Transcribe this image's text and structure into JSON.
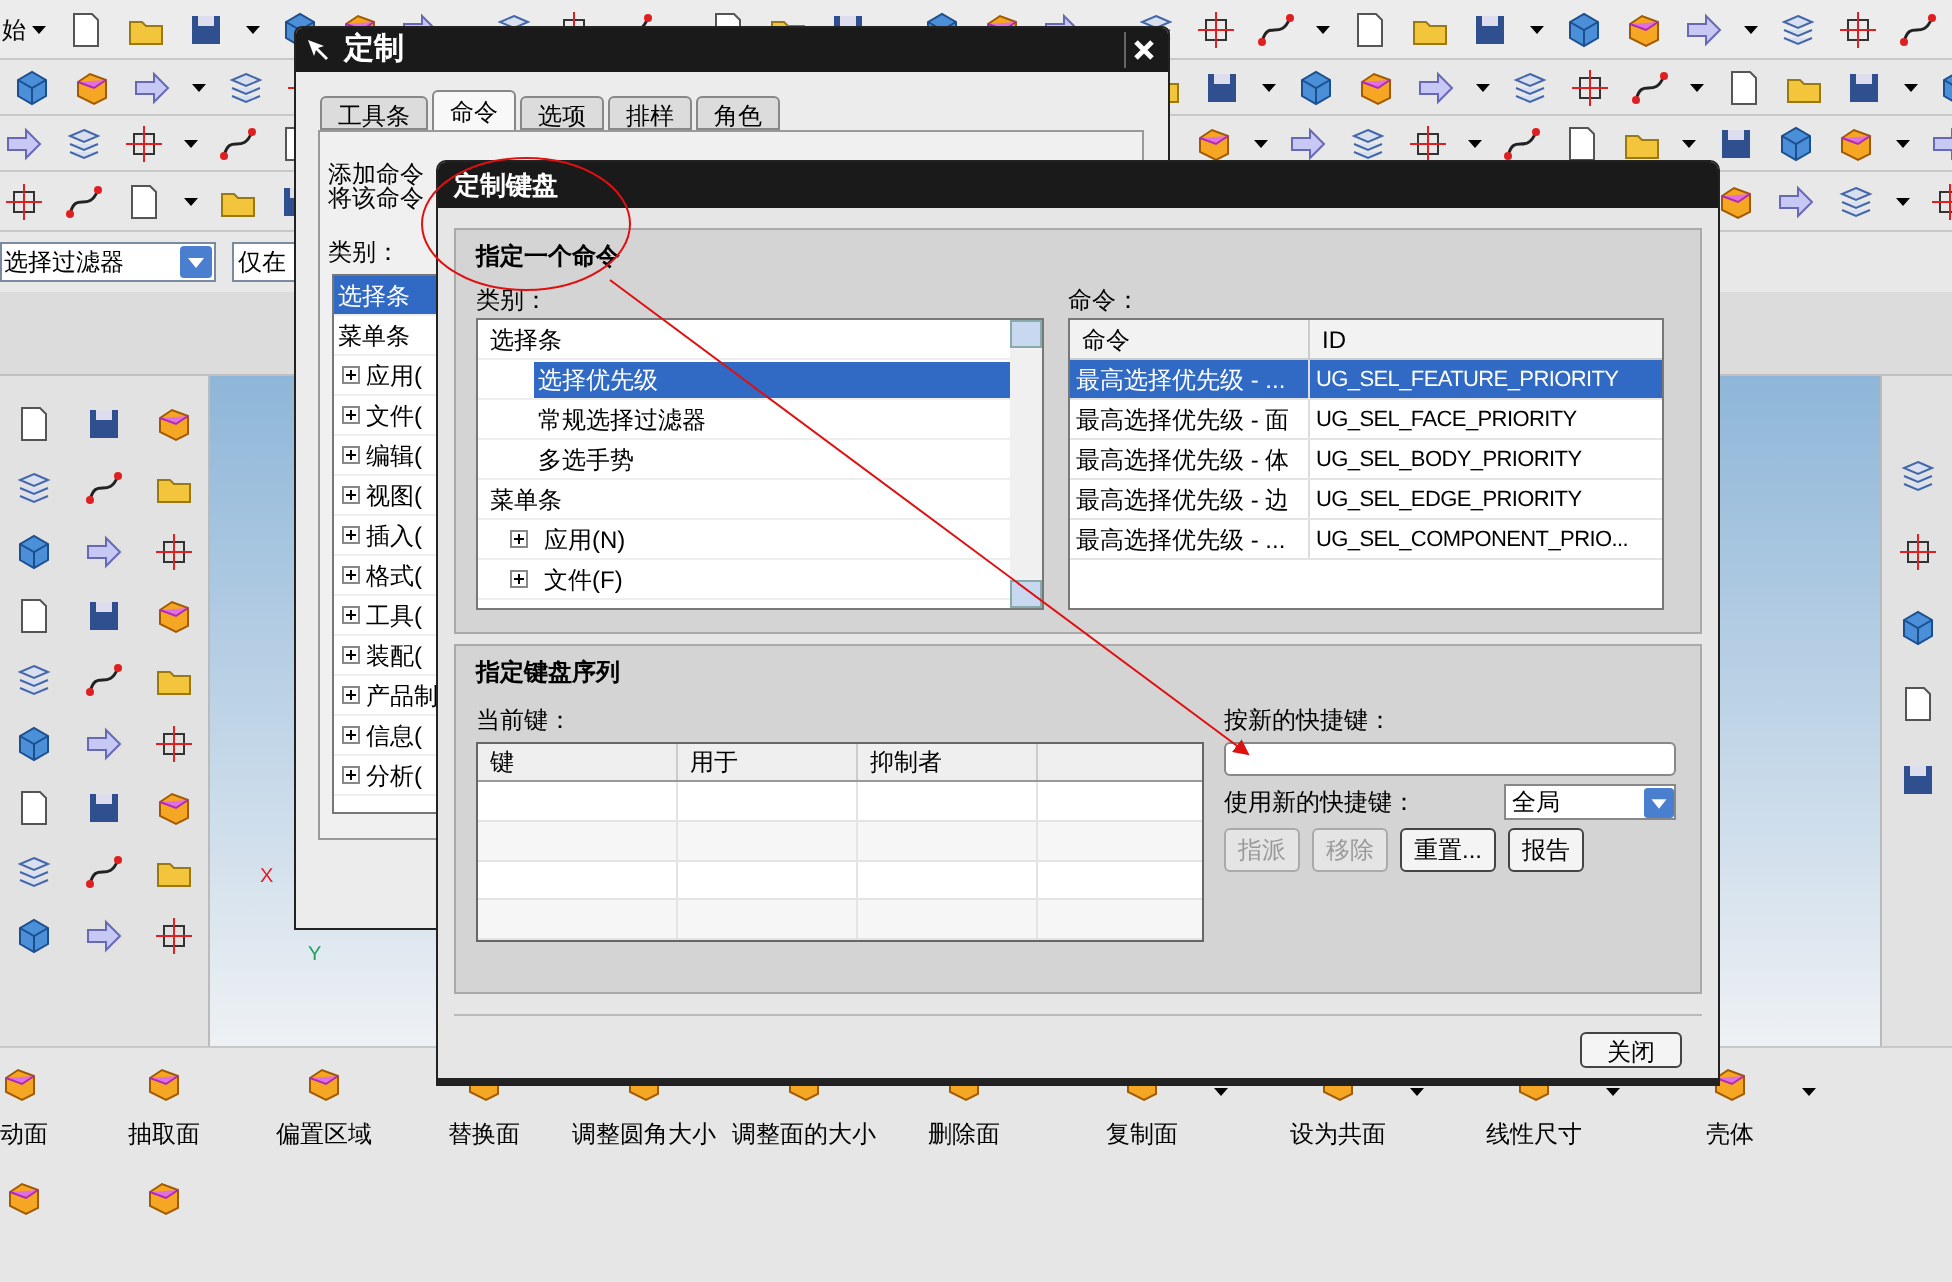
{
  "app": {
    "menu_button": "始",
    "filter": {
      "value": "选择过滤器"
    },
    "filter_scope": {
      "value": "仅在"
    },
    "triad": {
      "x_label": "X",
      "y_label": "Y"
    }
  },
  "bottom_toolbar": [
    {
      "label": "动面",
      "has_menu": false
    },
    {
      "label": "抽取面",
      "has_menu": false
    },
    {
      "label": "偏置区域",
      "has_menu": false
    },
    {
      "label": "替换面",
      "has_menu": false
    },
    {
      "label": "调整圆角大小",
      "has_menu": false
    },
    {
      "label": "调整面的大小",
      "has_menu": false
    },
    {
      "label": "删除面",
      "has_menu": false
    },
    {
      "label": "复制面",
      "has_menu": true
    },
    {
      "label": "设为共面",
      "has_menu": true
    },
    {
      "label": "线性尺寸",
      "has_menu": true
    },
    {
      "label": "壳体",
      "has_menu": true
    }
  ],
  "customize_dialog": {
    "title": "定制",
    "tabs": [
      {
        "label": "工具条",
        "selected": false
      },
      {
        "label": "命令",
        "selected": true
      },
      {
        "label": "选项",
        "selected": false
      },
      {
        "label": "排样",
        "selected": false
      },
      {
        "label": "角色",
        "selected": false
      }
    ],
    "description_lines": [
      "添加命令",
      "将该命令"
    ],
    "category_label": "类别：",
    "categories": [
      {
        "label": "选择条",
        "selected": true
      },
      {
        "label": "菜单条",
        "selected": false,
        "expanded": true,
        "children": [
          {
            "label": "应用(",
            "selected": false,
            "expanded": false
          },
          {
            "label": "文件(",
            "selected": false,
            "expanded": false
          },
          {
            "label": "编辑(",
            "selected": false,
            "expanded": false
          },
          {
            "label": "视图(",
            "selected": false,
            "expanded": false
          },
          {
            "label": "插入(",
            "selected": false,
            "expanded": false
          },
          {
            "label": "格式(",
            "selected": false,
            "expanded": false
          },
          {
            "label": "工具(",
            "selected": false,
            "expanded": false
          },
          {
            "label": "装配(",
            "selected": false,
            "expanded": false
          },
          {
            "label": "产品制",
            "selected": false,
            "expanded": false
          },
          {
            "label": "信息(",
            "selected": false,
            "expanded": false
          },
          {
            "label": "分析(",
            "selected": false,
            "expanded": false
          }
        ]
      }
    ]
  },
  "keyboard_dialog": {
    "title": "定制键盘",
    "command_group": {
      "title": "指定一个命令",
      "category_label": "类别：",
      "command_label": "命令：",
      "categories": [
        {
          "label": "选择条",
          "selected": false,
          "expanded": true,
          "children": [
            {
              "label": "选择优先级",
              "selected": true
            },
            {
              "label": "常规选择过滤器",
              "selected": false
            },
            {
              "label": "多选手势",
              "selected": false
            }
          ]
        },
        {
          "label": "菜单条",
          "selected": false,
          "expanded": true,
          "children": [
            {
              "label": "应用(N)",
              "selected": false,
              "expanded": false
            },
            {
              "label": "文件(F)",
              "selected": false,
              "expanded": false
            }
          ]
        }
      ],
      "command_columns": [
        "命令",
        "ID"
      ],
      "commands": [
        {
          "command": "最高选择优先级 - ...",
          "id": "UG_SEL_FEATURE_PRIORITY",
          "selected": true
        },
        {
          "command": "最高选择优先级 - 面",
          "id": "UG_SEL_FACE_PRIORITY",
          "selected": false
        },
        {
          "command": "最高选择优先级 - 体",
          "id": "UG_SEL_BODY_PRIORITY",
          "selected": false
        },
        {
          "command": "最高选择优先级 - 边",
          "id": "UG_SEL_EDGE_PRIORITY",
          "selected": false
        },
        {
          "command": "最高选择优先级 - ...",
          "id": "UG_SEL_COMPONENT_PRIO...",
          "selected": false
        }
      ]
    },
    "sequence_group": {
      "title": "指定键盘序列",
      "current_keys_label": "当前键：",
      "key_columns": [
        "键",
        "用于",
        "抑制者"
      ],
      "new_key_label": "按新的快捷键：",
      "use_label": "使用新的快捷键：",
      "use_value": "全局",
      "buttons": [
        {
          "label": "指派",
          "disabled": true
        },
        {
          "label": "移除",
          "disabled": true
        },
        {
          "label": "重置...",
          "disabled": false
        },
        {
          "label": "报告",
          "disabled": false
        }
      ]
    },
    "close_button": "关闭"
  }
}
